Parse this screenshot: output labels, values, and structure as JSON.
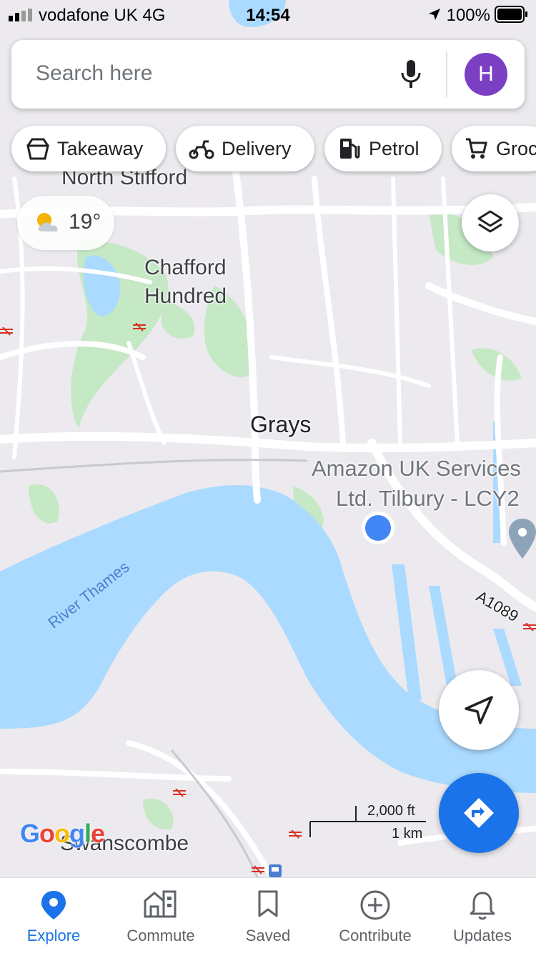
{
  "status_bar": {
    "carrier": "vodafone UK   4G",
    "time": "14:54",
    "battery": "100%"
  },
  "search": {
    "placeholder": "Search here",
    "avatar_initial": "H"
  },
  "chips": [
    {
      "label": "Takeaway",
      "icon": "takeaway-icon"
    },
    {
      "label": "Delivery",
      "icon": "delivery-icon"
    },
    {
      "label": "Petrol",
      "icon": "petrol-icon"
    },
    {
      "label": "Groc",
      "icon": "cart-icon"
    }
  ],
  "weather": {
    "temperature": "19°",
    "icon": "partly-cloudy-icon"
  },
  "map": {
    "labels": {
      "north_stifford": "North Stifford",
      "chafford_line1": "Chafford",
      "chafford_line2": "Hundred",
      "grays": "Grays",
      "amazon_line1": "Amazon UK Services",
      "amazon_line2": "Ltd. Tilbury - LCY2",
      "river": "River Thames",
      "road": "A1089",
      "swanscombe": "Swanscombe"
    },
    "scale": {
      "imperial": "2,000 ft",
      "metric": "1 km"
    },
    "attribution": "Google",
    "colors": {
      "water": "#aadaff",
      "land": "#eceaee",
      "park": "#c5e8c5",
      "road": "#ffffff",
      "accent": "#1a73e8"
    }
  },
  "nav": {
    "items": [
      {
        "label": "Explore",
        "icon": "explore-pin-icon",
        "active": true
      },
      {
        "label": "Commute",
        "icon": "commute-icon",
        "active": false
      },
      {
        "label": "Saved",
        "icon": "bookmark-icon",
        "active": false
      },
      {
        "label": "Contribute",
        "icon": "add-circle-icon",
        "active": false
      },
      {
        "label": "Updates",
        "icon": "bell-icon",
        "active": false
      }
    ]
  }
}
